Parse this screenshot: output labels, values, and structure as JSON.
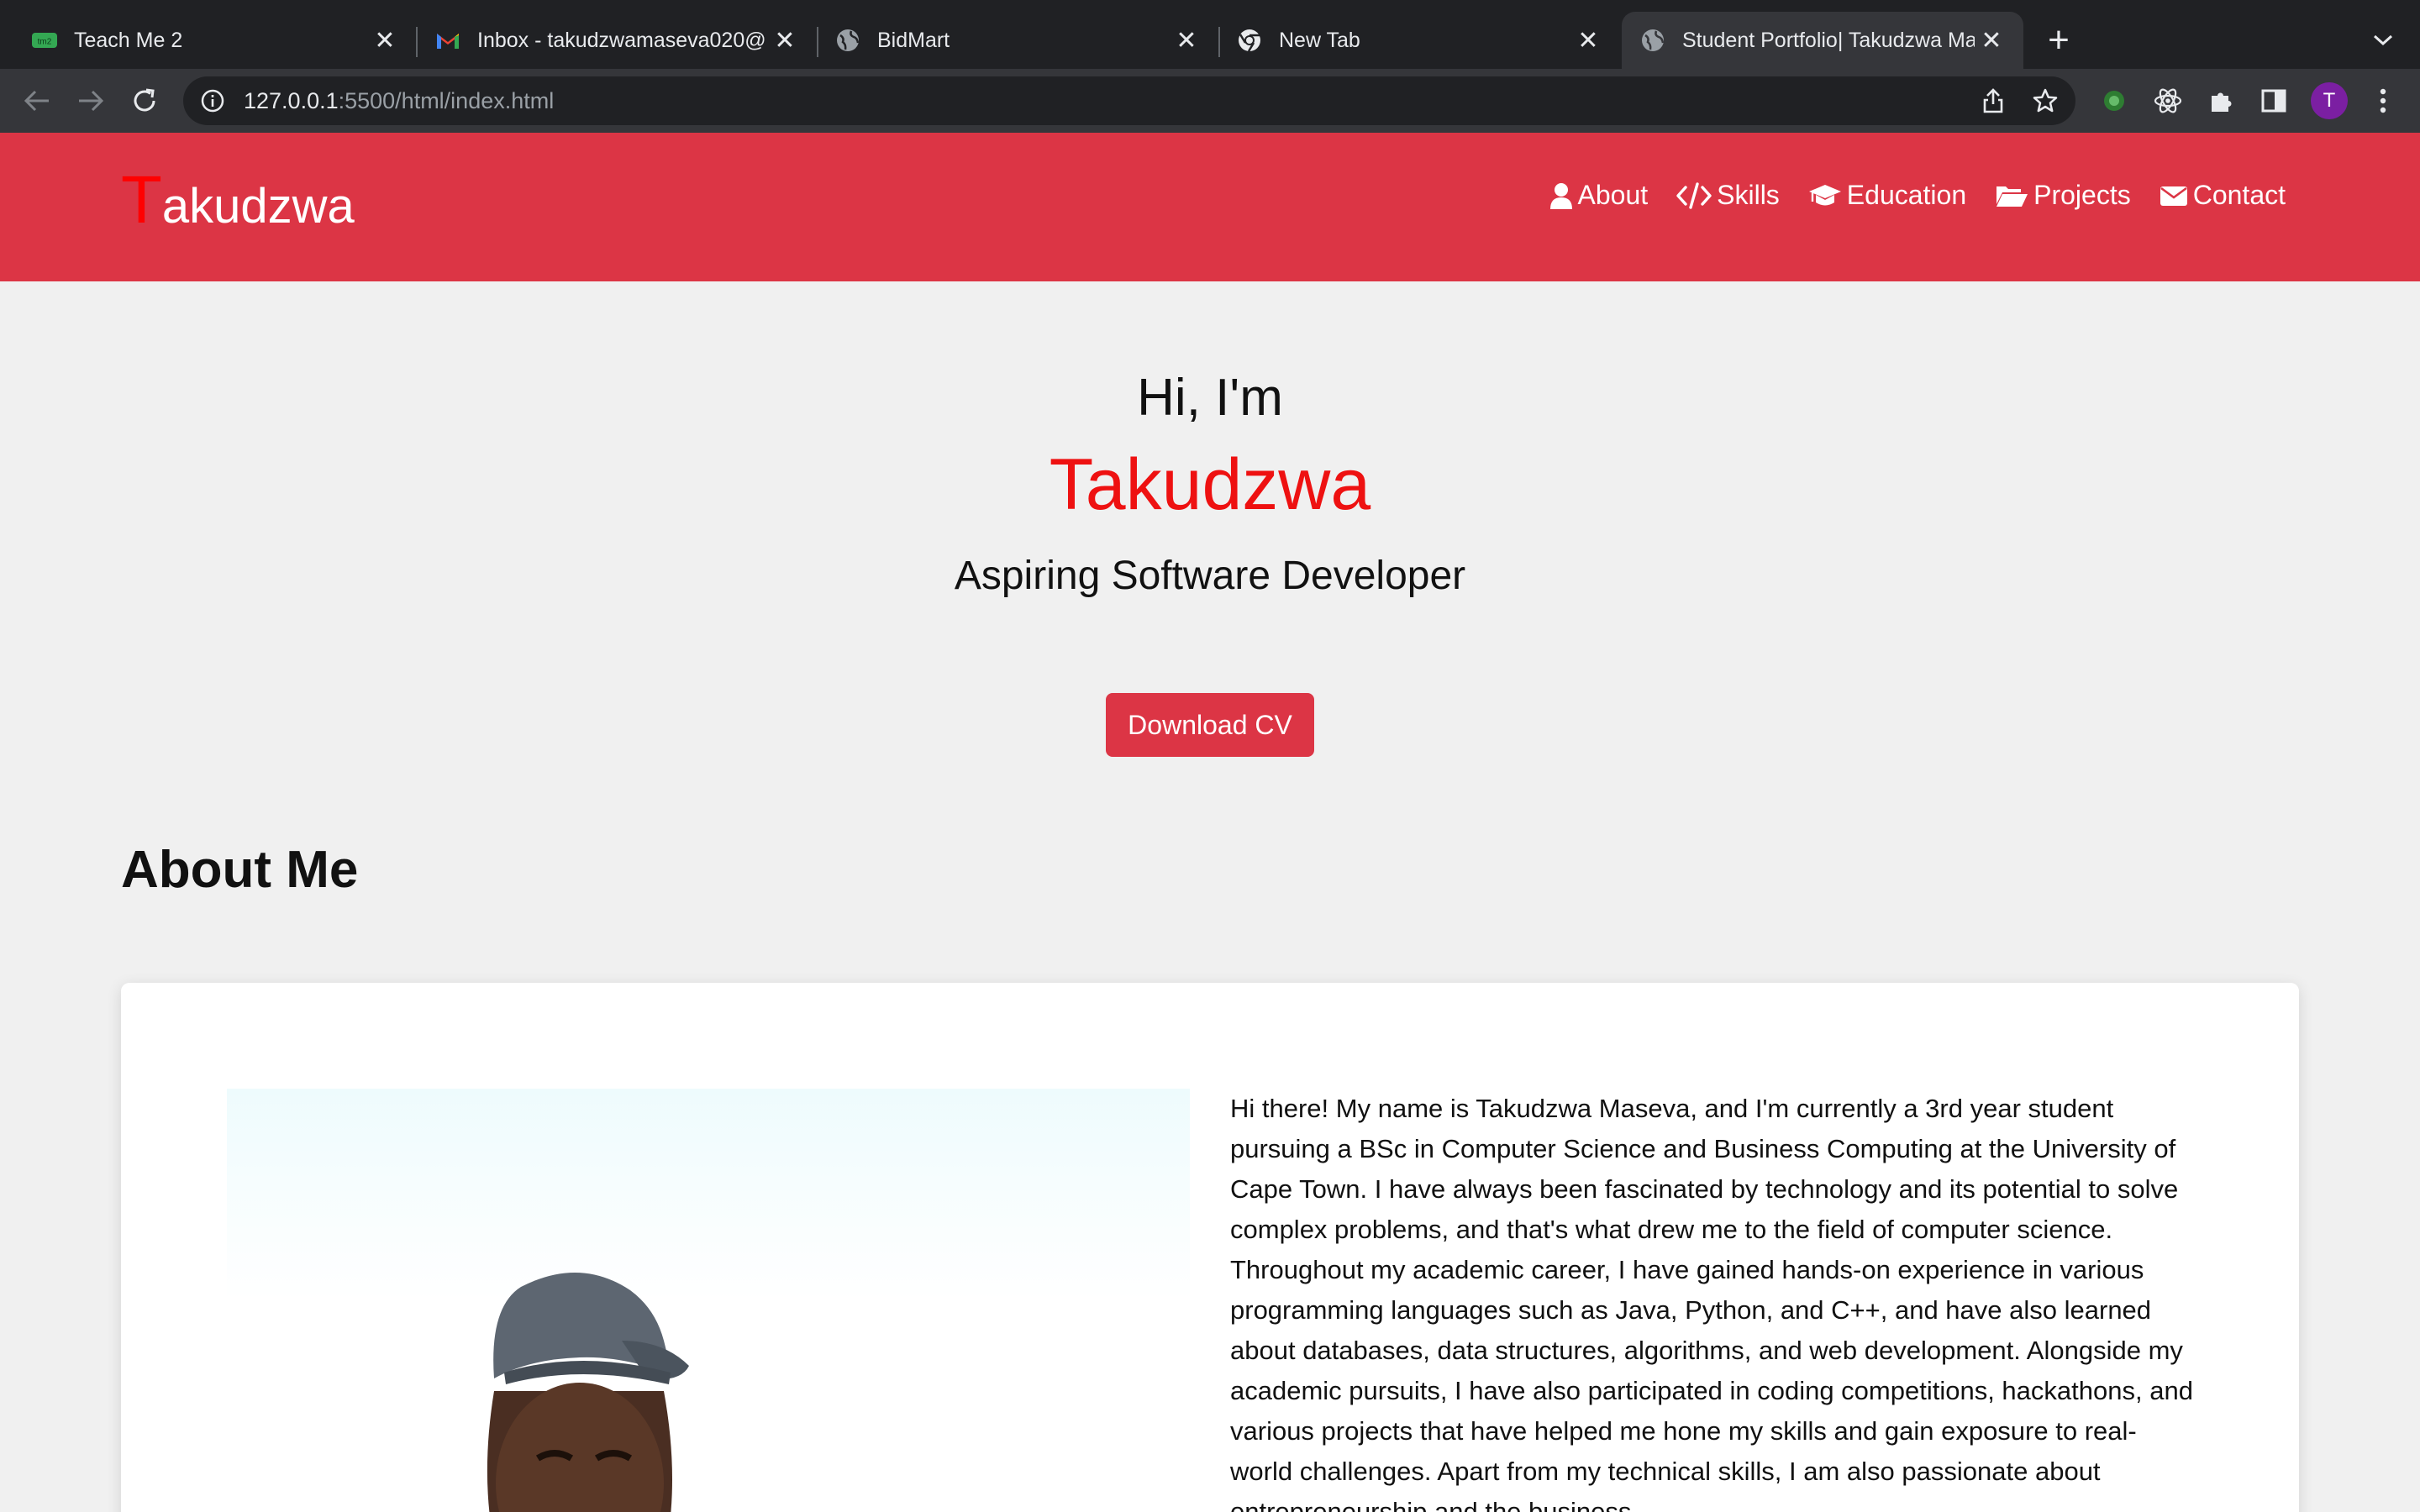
{
  "browser": {
    "tabs": [
      {
        "title": "Teach Me 2",
        "favicon": "tm2-icon",
        "active": false
      },
      {
        "title": "Inbox - takudzwamaseva020@",
        "favicon": "gmail-icon",
        "active": false
      },
      {
        "title": "BidMart",
        "favicon": "globe-icon",
        "active": false
      },
      {
        "title": "New Tab",
        "favicon": "chrome-icon",
        "active": false
      },
      {
        "title": "Student Portfolio| Takudzwa Ma",
        "favicon": "globe-icon",
        "active": true
      }
    ],
    "url_host": "127.0.0.1",
    "url_rest": ":5500/html/index.html",
    "profile_initial": "T",
    "tm2_badge": "tm2"
  },
  "header": {
    "logo_first": "T",
    "logo_rest": "akudzwa",
    "nav": [
      {
        "label": "About",
        "icon": "user-icon"
      },
      {
        "label": "Skills",
        "icon": "code-icon"
      },
      {
        "label": "Education",
        "icon": "graduation-cap-icon"
      },
      {
        "label": "Projects",
        "icon": "folder-open-icon"
      },
      {
        "label": "Contact",
        "icon": "envelope-icon"
      }
    ]
  },
  "hero": {
    "greeting": "Hi, I'm",
    "name": "Takudzwa",
    "role": "Aspiring Software Developer",
    "cv_button": "Download CV"
  },
  "about": {
    "heading": "About Me",
    "text": "Hi there! My name is Takudzwa Maseva, and I'm currently a 3rd year student pursuing a BSc in Computer Science and Business Computing at the University of Cape Town. I have always been fascinated by technology and its potential to solve complex problems, and that's what drew me to the field of computer science. Throughout my academic career, I have gained hands-on experience in various programming languages such as Java, Python, and C++, and have also learned about databases, data structures, algorithms, and web development. Alongside my academic pursuits, I have also participated in coding competitions, hackathons, and various projects that have helped me hone my skills and gain exposure to real-world challenges. Apart from my technical skills, I am also passionate about entrepreneurship and the business"
  },
  "colors": {
    "brand_red": "#dc3545",
    "name_red": "#ee1111",
    "page_bg": "#f0f0f0"
  }
}
